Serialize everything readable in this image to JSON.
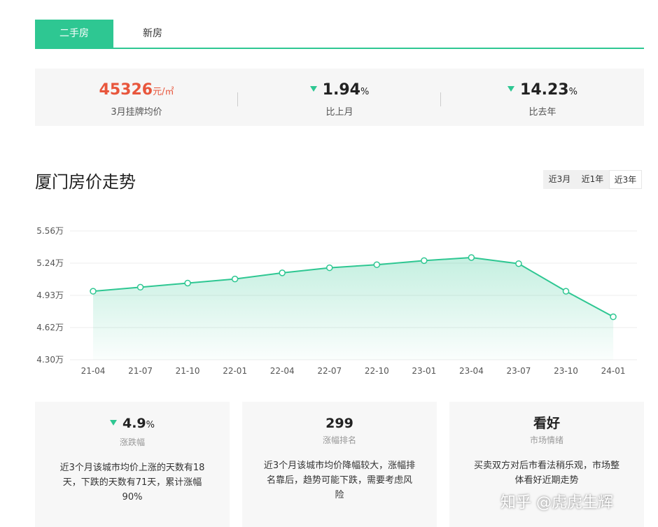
{
  "tabs": [
    {
      "label": "二手房",
      "active": true
    },
    {
      "label": "新房",
      "active": false
    }
  ],
  "stats": {
    "price": {
      "value": "45326",
      "unit": "元/㎡",
      "label": "3月挂牌均价"
    },
    "mom": {
      "value": "1.94",
      "unit": "%",
      "label": "比上月",
      "direction": "down"
    },
    "yoy": {
      "value": "14.23",
      "unit": "%",
      "label": "比去年",
      "direction": "down"
    }
  },
  "section_title": "厦门房价走势",
  "range_buttons": [
    "近3月",
    "近1年",
    "近3年"
  ],
  "range_selected": "近3年",
  "colors": {
    "accent": "#2ec792",
    "price": "#e8563c"
  },
  "chart_data": {
    "type": "area",
    "title": "",
    "xlabel": "",
    "ylabel": "",
    "categories": [
      "21-04",
      "21-07",
      "21-10",
      "22-01",
      "22-04",
      "22-07",
      "22-10",
      "23-01",
      "23-04",
      "23-07",
      "23-10",
      "24-01"
    ],
    "values": [
      4.97,
      5.01,
      5.05,
      5.09,
      5.15,
      5.2,
      5.23,
      5.27,
      5.3,
      5.24,
      4.97,
      4.72
    ],
    "y_ticks": [
      "5.56万",
      "5.24万",
      "4.93万",
      "4.62万",
      "4.30万"
    ],
    "ylim": [
      4.3,
      5.56
    ],
    "grid": true,
    "color": "#2ec792"
  },
  "cards": [
    {
      "value": "4.9",
      "unit": "%",
      "direction": "down",
      "label": "涨跌幅",
      "desc": "近3个月该城市均价上涨的天数有18天，下跌的天数有71天，累计涨幅90%"
    },
    {
      "value": "299",
      "label": "涨幅排名",
      "desc": "近3个月该城市均价降幅较大，涨幅排名靠后，趋势可能下跌，需要考虑风险"
    },
    {
      "value": "看好",
      "label": "市场情绪",
      "desc": "买卖双方对后市看法稍乐观，市场整体看好近期走势"
    }
  ],
  "watermark": "知乎 @虎虎生辉"
}
